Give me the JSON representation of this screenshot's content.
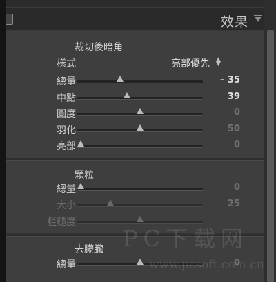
{
  "panel": {
    "title": "效果",
    "collapse_icon": "square-toggle-icon",
    "menu_icon": "triangle-down-icon"
  },
  "vignette": {
    "title": "裁切後暗角",
    "style_label": "樣式",
    "style_value": "亮部優先",
    "sliders": [
      {
        "label": "總量",
        "value": "– 35",
        "level": 0.33,
        "active": true,
        "value_bright": true
      },
      {
        "label": "中點",
        "value": "39",
        "level": 0.39,
        "active": true,
        "value_bright": true
      },
      {
        "label": "圓度",
        "value": "0",
        "level": 0.5,
        "active": true,
        "value_bright": false
      },
      {
        "label": "羽化",
        "value": "50",
        "level": 0.5,
        "active": true,
        "value_bright": false
      },
      {
        "label": "亮部",
        "value": "0",
        "level": 0.0,
        "active": true,
        "value_bright": false
      }
    ]
  },
  "grain": {
    "title": "顆粒",
    "sliders": [
      {
        "label": "總量",
        "value": "0",
        "level": 0.0,
        "active": true,
        "value_bright": false
      },
      {
        "label": "大小",
        "value": "25",
        "level": 0.25,
        "active": false,
        "value_bright": false
      },
      {
        "label": "粗糙度",
        "value": "",
        "level": 0.5,
        "active": false,
        "value_bright": false
      }
    ]
  },
  "dehaze": {
    "title": "去朦朧",
    "sliders": [
      {
        "label": "總量",
        "value": "0",
        "level": 0.5,
        "active": true,
        "value_bright": false
      }
    ]
  },
  "watermark": {
    "logo_text": "PC下载网",
    "url": "www.pcsoft.com.cn"
  }
}
